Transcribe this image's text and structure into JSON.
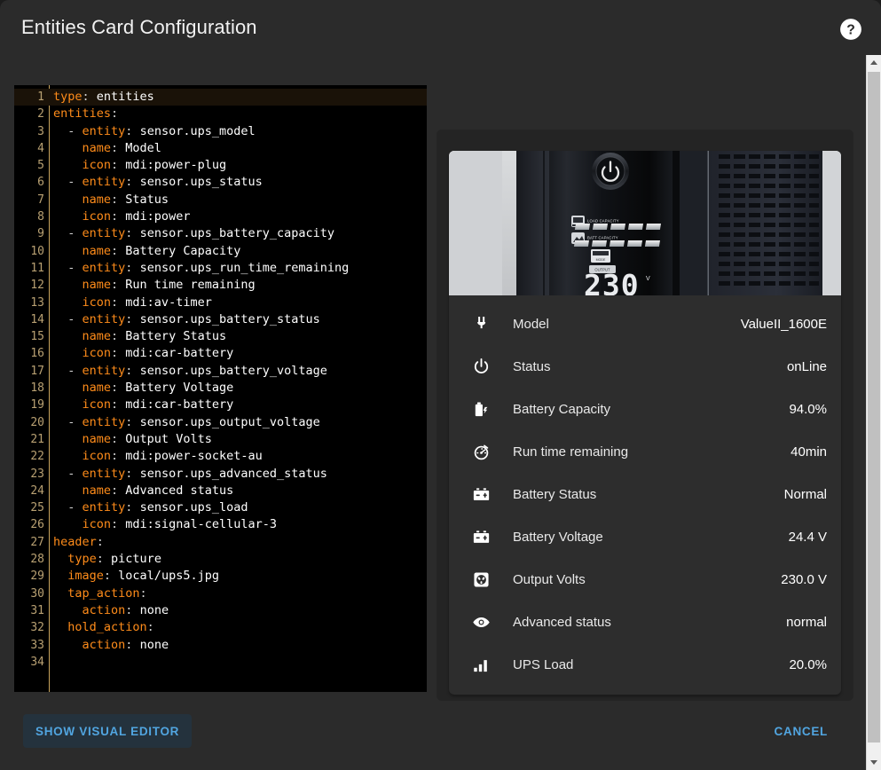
{
  "header": {
    "title": "Entities Card Configuration",
    "help_icon": "help-circle-icon"
  },
  "editor": {
    "language": "yaml",
    "active_line": 1,
    "total_lines": 34,
    "lines": [
      {
        "n": "1",
        "tokens": [
          {
            "t": "k",
            "s": "type"
          },
          {
            "t": "p",
            "s": ": "
          },
          {
            "t": "v",
            "s": "entities"
          }
        ]
      },
      {
        "n": "2",
        "tokens": [
          {
            "t": "k",
            "s": "entities"
          },
          {
            "t": "p",
            "s": ":"
          }
        ]
      },
      {
        "n": "3",
        "tokens": [
          {
            "t": "p",
            "s": "  - "
          },
          {
            "t": "k",
            "s": "entity"
          },
          {
            "t": "p",
            "s": ": "
          },
          {
            "t": "v",
            "s": "sensor.ups_model"
          }
        ]
      },
      {
        "n": "4",
        "tokens": [
          {
            "t": "p",
            "s": "    "
          },
          {
            "t": "k",
            "s": "name"
          },
          {
            "t": "p",
            "s": ": "
          },
          {
            "t": "v",
            "s": "Model"
          }
        ]
      },
      {
        "n": "5",
        "tokens": [
          {
            "t": "p",
            "s": "    "
          },
          {
            "t": "k",
            "s": "icon"
          },
          {
            "t": "p",
            "s": ": "
          },
          {
            "t": "v",
            "s": "mdi:power-plug"
          }
        ]
      },
      {
        "n": "6",
        "tokens": [
          {
            "t": "p",
            "s": "  - "
          },
          {
            "t": "k",
            "s": "entity"
          },
          {
            "t": "p",
            "s": ": "
          },
          {
            "t": "v",
            "s": "sensor.ups_status"
          }
        ]
      },
      {
        "n": "7",
        "tokens": [
          {
            "t": "p",
            "s": "    "
          },
          {
            "t": "k",
            "s": "name"
          },
          {
            "t": "p",
            "s": ": "
          },
          {
            "t": "v",
            "s": "Status"
          }
        ]
      },
      {
        "n": "8",
        "tokens": [
          {
            "t": "p",
            "s": "    "
          },
          {
            "t": "k",
            "s": "icon"
          },
          {
            "t": "p",
            "s": ": "
          },
          {
            "t": "v",
            "s": "mdi:power"
          }
        ]
      },
      {
        "n": "9",
        "tokens": [
          {
            "t": "p",
            "s": "  - "
          },
          {
            "t": "k",
            "s": "entity"
          },
          {
            "t": "p",
            "s": ": "
          },
          {
            "t": "v",
            "s": "sensor.ups_battery_capacity"
          }
        ]
      },
      {
        "n": "10",
        "tokens": [
          {
            "t": "p",
            "s": "    "
          },
          {
            "t": "k",
            "s": "name"
          },
          {
            "t": "p",
            "s": ": "
          },
          {
            "t": "v",
            "s": "Battery Capacity"
          }
        ]
      },
      {
        "n": "11",
        "tokens": [
          {
            "t": "p",
            "s": "  - "
          },
          {
            "t": "k",
            "s": "entity"
          },
          {
            "t": "p",
            "s": ": "
          },
          {
            "t": "v",
            "s": "sensor.ups_run_time_remaining"
          }
        ]
      },
      {
        "n": "12",
        "tokens": [
          {
            "t": "p",
            "s": "    "
          },
          {
            "t": "k",
            "s": "name"
          },
          {
            "t": "p",
            "s": ": "
          },
          {
            "t": "v",
            "s": "Run time remaining"
          }
        ]
      },
      {
        "n": "13",
        "tokens": [
          {
            "t": "p",
            "s": "    "
          },
          {
            "t": "k",
            "s": "icon"
          },
          {
            "t": "p",
            "s": ": "
          },
          {
            "t": "v",
            "s": "mdi:av-timer"
          }
        ]
      },
      {
        "n": "14",
        "tokens": [
          {
            "t": "p",
            "s": "  - "
          },
          {
            "t": "k",
            "s": "entity"
          },
          {
            "t": "p",
            "s": ": "
          },
          {
            "t": "v",
            "s": "sensor.ups_battery_status"
          }
        ]
      },
      {
        "n": "15",
        "tokens": [
          {
            "t": "p",
            "s": "    "
          },
          {
            "t": "k",
            "s": "name"
          },
          {
            "t": "p",
            "s": ": "
          },
          {
            "t": "v",
            "s": "Battery Status"
          }
        ]
      },
      {
        "n": "16",
        "tokens": [
          {
            "t": "p",
            "s": "    "
          },
          {
            "t": "k",
            "s": "icon"
          },
          {
            "t": "p",
            "s": ": "
          },
          {
            "t": "v",
            "s": "mdi:car-battery"
          }
        ]
      },
      {
        "n": "17",
        "tokens": [
          {
            "t": "p",
            "s": "  - "
          },
          {
            "t": "k",
            "s": "entity"
          },
          {
            "t": "p",
            "s": ": "
          },
          {
            "t": "v",
            "s": "sensor.ups_battery_voltage"
          }
        ]
      },
      {
        "n": "18",
        "tokens": [
          {
            "t": "p",
            "s": "    "
          },
          {
            "t": "k",
            "s": "name"
          },
          {
            "t": "p",
            "s": ": "
          },
          {
            "t": "v",
            "s": "Battery Voltage"
          }
        ]
      },
      {
        "n": "19",
        "tokens": [
          {
            "t": "p",
            "s": "    "
          },
          {
            "t": "k",
            "s": "icon"
          },
          {
            "t": "p",
            "s": ": "
          },
          {
            "t": "v",
            "s": "mdi:car-battery"
          }
        ]
      },
      {
        "n": "20",
        "tokens": [
          {
            "t": "p",
            "s": "  - "
          },
          {
            "t": "k",
            "s": "entity"
          },
          {
            "t": "p",
            "s": ": "
          },
          {
            "t": "v",
            "s": "sensor.ups_output_voltage"
          }
        ]
      },
      {
        "n": "21",
        "tokens": [
          {
            "t": "p",
            "s": "    "
          },
          {
            "t": "k",
            "s": "name"
          },
          {
            "t": "p",
            "s": ": "
          },
          {
            "t": "v",
            "s": "Output Volts"
          }
        ]
      },
      {
        "n": "22",
        "tokens": [
          {
            "t": "p",
            "s": "    "
          },
          {
            "t": "k",
            "s": "icon"
          },
          {
            "t": "p",
            "s": ": "
          },
          {
            "t": "v",
            "s": "mdi:power-socket-au"
          }
        ]
      },
      {
        "n": "23",
        "tokens": [
          {
            "t": "p",
            "s": "  - "
          },
          {
            "t": "k",
            "s": "entity"
          },
          {
            "t": "p",
            "s": ": "
          },
          {
            "t": "v",
            "s": "sensor.ups_advanced_status"
          }
        ]
      },
      {
        "n": "24",
        "tokens": [
          {
            "t": "p",
            "s": "    "
          },
          {
            "t": "k",
            "s": "name"
          },
          {
            "t": "p",
            "s": ": "
          },
          {
            "t": "v",
            "s": "Advanced status"
          }
        ]
      },
      {
        "n": "25",
        "tokens": [
          {
            "t": "p",
            "s": "  - "
          },
          {
            "t": "k",
            "s": "entity"
          },
          {
            "t": "p",
            "s": ": "
          },
          {
            "t": "v",
            "s": "sensor.ups_load"
          }
        ]
      },
      {
        "n": "26",
        "tokens": [
          {
            "t": "p",
            "s": "    "
          },
          {
            "t": "k",
            "s": "icon"
          },
          {
            "t": "p",
            "s": ": "
          },
          {
            "t": "v",
            "s": "mdi:signal-cellular-3"
          }
        ]
      },
      {
        "n": "27",
        "tokens": [
          {
            "t": "k",
            "s": "header"
          },
          {
            "t": "p",
            "s": ":"
          }
        ]
      },
      {
        "n": "28",
        "tokens": [
          {
            "t": "p",
            "s": "  "
          },
          {
            "t": "k",
            "s": "type"
          },
          {
            "t": "p",
            "s": ": "
          },
          {
            "t": "v",
            "s": "picture"
          }
        ]
      },
      {
        "n": "29",
        "tokens": [
          {
            "t": "p",
            "s": "  "
          },
          {
            "t": "k",
            "s": "image"
          },
          {
            "t": "p",
            "s": ": "
          },
          {
            "t": "v",
            "s": "local/ups5.jpg"
          }
        ]
      },
      {
        "n": "30",
        "tokens": [
          {
            "t": "p",
            "s": "  "
          },
          {
            "t": "k",
            "s": "tap_action"
          },
          {
            "t": "p",
            "s": ":"
          }
        ]
      },
      {
        "n": "31",
        "tokens": [
          {
            "t": "p",
            "s": "    "
          },
          {
            "t": "k",
            "s": "action"
          },
          {
            "t": "p",
            "s": ": "
          },
          {
            "t": "v",
            "s": "none"
          }
        ]
      },
      {
        "n": "32",
        "tokens": [
          {
            "t": "p",
            "s": "  "
          },
          {
            "t": "k",
            "s": "hold_action"
          },
          {
            "t": "p",
            "s": ":"
          }
        ]
      },
      {
        "n": "33",
        "tokens": [
          {
            "t": "p",
            "s": "    "
          },
          {
            "t": "k",
            "s": "action"
          },
          {
            "t": "p",
            "s": ": "
          },
          {
            "t": "v",
            "s": "none"
          }
        ]
      },
      {
        "n": "34",
        "tokens": []
      }
    ]
  },
  "preview": {
    "card_header": {
      "type": "picture",
      "image": "local/ups5.jpg",
      "display_reading": "230",
      "display_unit": "V",
      "label_load_capacity": "LOAD CAPACITY",
      "label_batt_capacity": "BATT CAPACITY",
      "label_mode": "MODE",
      "label_output": "OUTPUT"
    },
    "rows": [
      {
        "icon": "power-plug-icon",
        "name": "Model",
        "value": "ValueII_1600E"
      },
      {
        "icon": "power-icon",
        "name": "Status",
        "value": "onLine"
      },
      {
        "icon": "battery-charging-icon",
        "name": "Battery Capacity",
        "value": "94.0%"
      },
      {
        "icon": "av-timer-icon",
        "name": "Run time remaining",
        "value": "40min"
      },
      {
        "icon": "car-battery-icon",
        "name": "Battery Status",
        "value": "Normal"
      },
      {
        "icon": "car-battery-icon",
        "name": "Battery Voltage",
        "value": "24.4 V"
      },
      {
        "icon": "power-socket-au-icon",
        "name": "Output Volts",
        "value": "230.0 V"
      },
      {
        "icon": "eye-icon",
        "name": "Advanced status",
        "value": "normal"
      },
      {
        "icon": "signal-cellular-3-icon",
        "name": "UPS Load",
        "value": "20.0%"
      }
    ]
  },
  "footer": {
    "show_visual_editor_label": "SHOW VISUAL EDITOR",
    "cancel_label": "CANCEL"
  },
  "colors": {
    "accent_blue": "#51a5e0",
    "dialog_bg": "#2b2b2b",
    "card_bg": "#2d2d2d",
    "editor_bg": "#000000",
    "yaml_key": "#ff8c1a",
    "yaml_value": "#ffffff",
    "line_number": "#b8a072"
  }
}
